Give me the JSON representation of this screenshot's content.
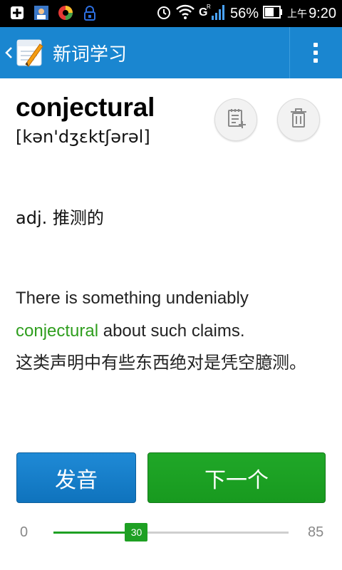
{
  "status_bar": {
    "battery_pct": "56%",
    "ampm": "上午",
    "time": "9:20",
    "icons": [
      "notification-plus-icon",
      "contacts-icon",
      "app-swirl-icon",
      "lock-app-icon",
      "alarm-icon",
      "wifi-icon",
      "signal-g-icon",
      "battery-icon"
    ]
  },
  "action_bar": {
    "title": "新词学习",
    "bg_color": "#1a86d0"
  },
  "word": {
    "text": "conjectural",
    "phonetic": "[kən'dʒɛktʃərəl]",
    "meaning": "adj. 推测的"
  },
  "example": {
    "before": "There is something undeniably ",
    "highlight": "conjectural",
    "after": " about such claims.",
    "translation": "这类声明中有些东西绝对是凭空臆测。",
    "highlight_color": "#2f9e1e"
  },
  "buttons": {
    "pronounce": "发音",
    "next": "下一个"
  },
  "progress": {
    "min": "0",
    "max": "85",
    "current": "30",
    "fraction": 0.353
  }
}
